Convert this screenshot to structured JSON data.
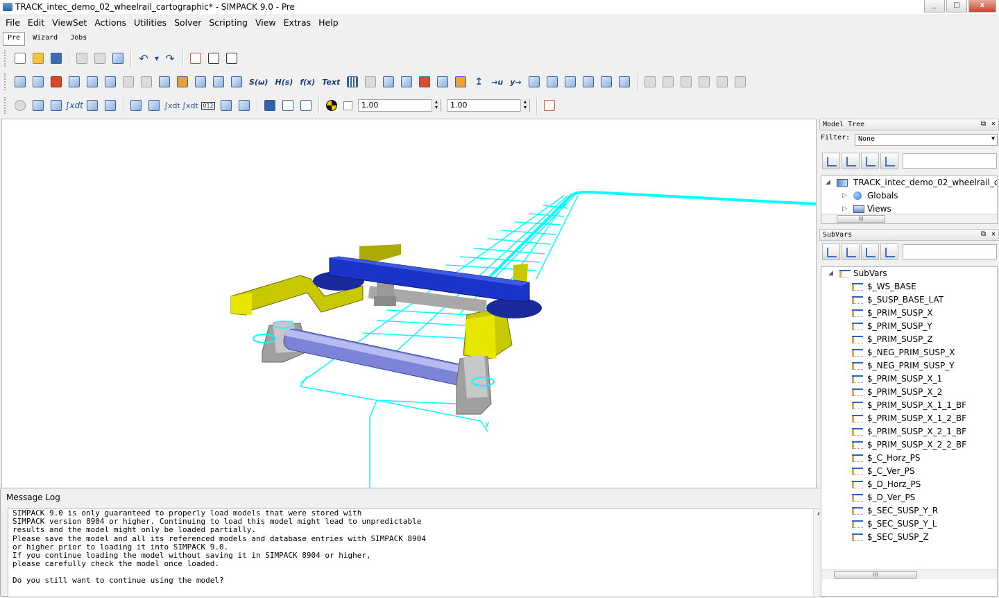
{
  "window": {
    "title": "TRACK_intec_demo_02_wheelrail_cartographic* - SIMPACK 9.0 - Pre",
    "minimize": "_",
    "maximize": "□",
    "close": "x"
  },
  "menu": [
    "File",
    "Edit",
    "ViewSet",
    "Actions",
    "Utilities",
    "Solver",
    "Scripting",
    "View",
    "Extras",
    "Help"
  ],
  "modes": [
    "Pre",
    "Wizard",
    "Jobs"
  ],
  "toolbar": {
    "text_buttons": [
      "S(ω)",
      "H(s)",
      "f(x)",
      "Text"
    ],
    "text_buttons2": [
      "→u",
      "y→"
    ],
    "spin1_value": "1.00",
    "spin2_value": "1.00"
  },
  "viewport": {
    "axis_label": "y",
    "colors": {
      "track": "#00ffff",
      "car_body": "#1a2fbf",
      "bogie": "#aaaa00",
      "wheelset": "#8888dd",
      "housing": "#aaaaaa"
    }
  },
  "message_log": {
    "title": "Message Log",
    "lines": [
      "SIMPACK 9.0 is only guaranteed to properly load models that were stored with",
      "SIMPACK version 8904 or higher. Continuing to load this model might lead to unpredictable",
      "results and the model might only be loaded partially.",
      "Please save the model and all its referenced models and database entries with SIMPACK 8904",
      "or higher prior to loading it into SIMPACK 9.0.",
      "If you continue loading the model without saving it in SIMPACK 8904 or higher,",
      "please carefully check the model once loaded.",
      "",
      "Do you still want to continue using the model?"
    ]
  },
  "model_tree": {
    "title": "Model Tree",
    "filter_label": "Filter:",
    "filter_value": "None",
    "items": [
      {
        "label": "TRACK_intec_demo_02_wheelrail_c",
        "icon": "model-icon"
      },
      {
        "label": "Globals",
        "icon": "globe-icon"
      },
      {
        "label": "Views",
        "icon": "views-icon"
      }
    ],
    "scroll_thumb": "III"
  },
  "subvars": {
    "title": "SubVars",
    "root": "SubVars",
    "items": [
      "$_WS_BASE",
      "$_SUSP_BASE_LAT",
      "$_PRIM_SUSP_X",
      "$_PRIM_SUSP_Y",
      "$_PRIM_SUSP_Z",
      "$_NEG_PRIM_SUSP_X",
      "$_NEG_PRIM_SUSP_Y",
      "$_PRIM_SUSP_X_1",
      "$_PRIM_SUSP_X_2",
      "$_PRIM_SUSP_X_1_1_BF",
      "$_PRIM_SUSP_X_1_2_BF",
      "$_PRIM_SUSP_X_2_1_BF",
      "$_PRIM_SUSP_X_2_2_BF",
      "$_C_Horz_PS",
      "$_C_Ver_PS",
      "$_D_Horz_PS",
      "$_D_Ver_PS",
      "$_SEC_SUSP_Y_R",
      "$_SEC_SUSP_Y_L",
      "$_SEC_SUSP_Z"
    ],
    "scroll_thumb": "III"
  }
}
